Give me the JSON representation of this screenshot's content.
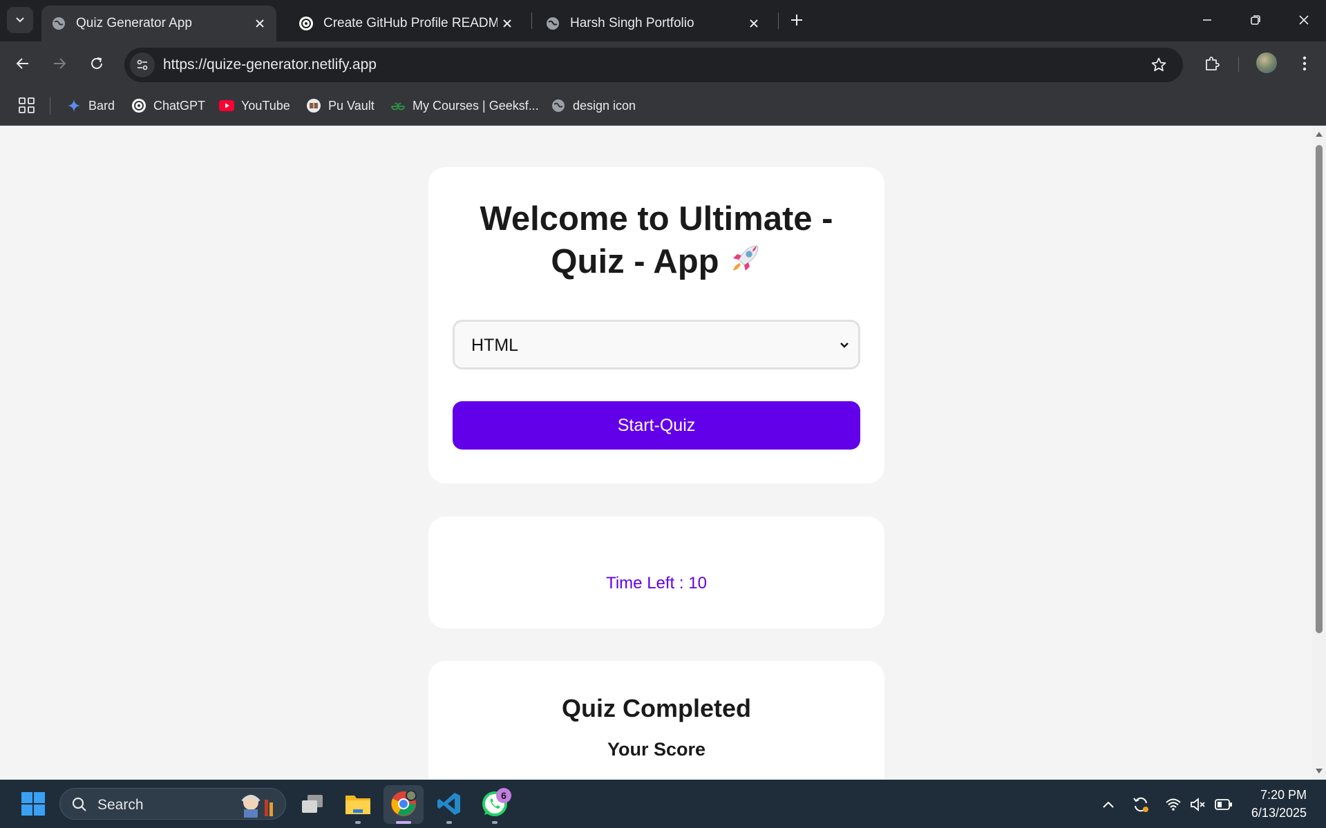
{
  "browser": {
    "tabs": [
      {
        "title": "Quiz Generator App",
        "active": true
      },
      {
        "title": "Create GitHub Profile README",
        "active": false
      },
      {
        "title": "Harsh Singh Portfolio",
        "active": false
      }
    ],
    "url": "https://quize-generator.netlify.app",
    "bookmarks": [
      {
        "label": "Bard",
        "icon": "sparkle-icon"
      },
      {
        "label": "ChatGPT",
        "icon": "chatgpt-icon"
      },
      {
        "label": "YouTube",
        "icon": "youtube-icon"
      },
      {
        "label": "Pu Vault",
        "icon": "book-icon"
      },
      {
        "label": "My Courses | Geeksf...",
        "icon": "geeksforgeeks-icon"
      },
      {
        "label": "design icon",
        "icon": "globe-icon"
      }
    ]
  },
  "page": {
    "welcome_title": "Welcome to Ultimate - Quiz - App",
    "welcome_emoji": "🚀",
    "topic_select": {
      "selected": "HTML"
    },
    "start_button": "Start-Quiz",
    "time_left": "Time Left : 10",
    "completed_title": "Quiz Completed",
    "score_title": "Your Score"
  },
  "taskbar": {
    "search_label": "Search",
    "whatsapp_badge": "6",
    "time": "7:20 PM",
    "date": "6/13/2025"
  },
  "colors": {
    "accent": "#6200ea",
    "page_bg": "#f4f4f4",
    "card_bg": "#ffffff"
  }
}
